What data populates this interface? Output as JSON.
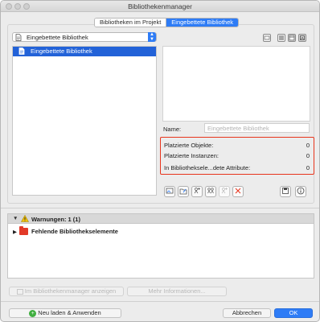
{
  "window": {
    "title": "Bibliothekenmanager"
  },
  "tabs": [
    {
      "label": "Bibliotheken im Projekt",
      "active": false
    },
    {
      "label": "Eingebettete Bibliothek",
      "active": true
    }
  ],
  "library_select": {
    "selected": "Eingebettete Bibliothek"
  },
  "tree": {
    "items": [
      {
        "label": "Eingebettete Bibliothek",
        "selected": true
      }
    ]
  },
  "details": {
    "name_label": "Name:",
    "name_placeholder": "Eingebettete Bibliothek",
    "stats": [
      {
        "label": "Platzierte Objekte:",
        "value": "0"
      },
      {
        "label": "Platzierte Instanzen:",
        "value": "0"
      },
      {
        "label": "In Bibliotheksele...dete Attribute:",
        "value": "0"
      }
    ]
  },
  "warnings": {
    "header": "Warnungen: 1 (1)",
    "items": [
      {
        "label": "Fehlende Bibliothekselemente"
      }
    ]
  },
  "buttons": {
    "show_in_manager": "Im Bibliothekenmanager anzeigen",
    "more_info": "Mehr Informationen...",
    "reload": "Neu laden & Anwenden",
    "cancel": "Abbrechen",
    "ok": "OK"
  },
  "colors": {
    "accent": "#2e7cf6",
    "highlight_border": "#e8341c",
    "folder": "#e23a28"
  }
}
